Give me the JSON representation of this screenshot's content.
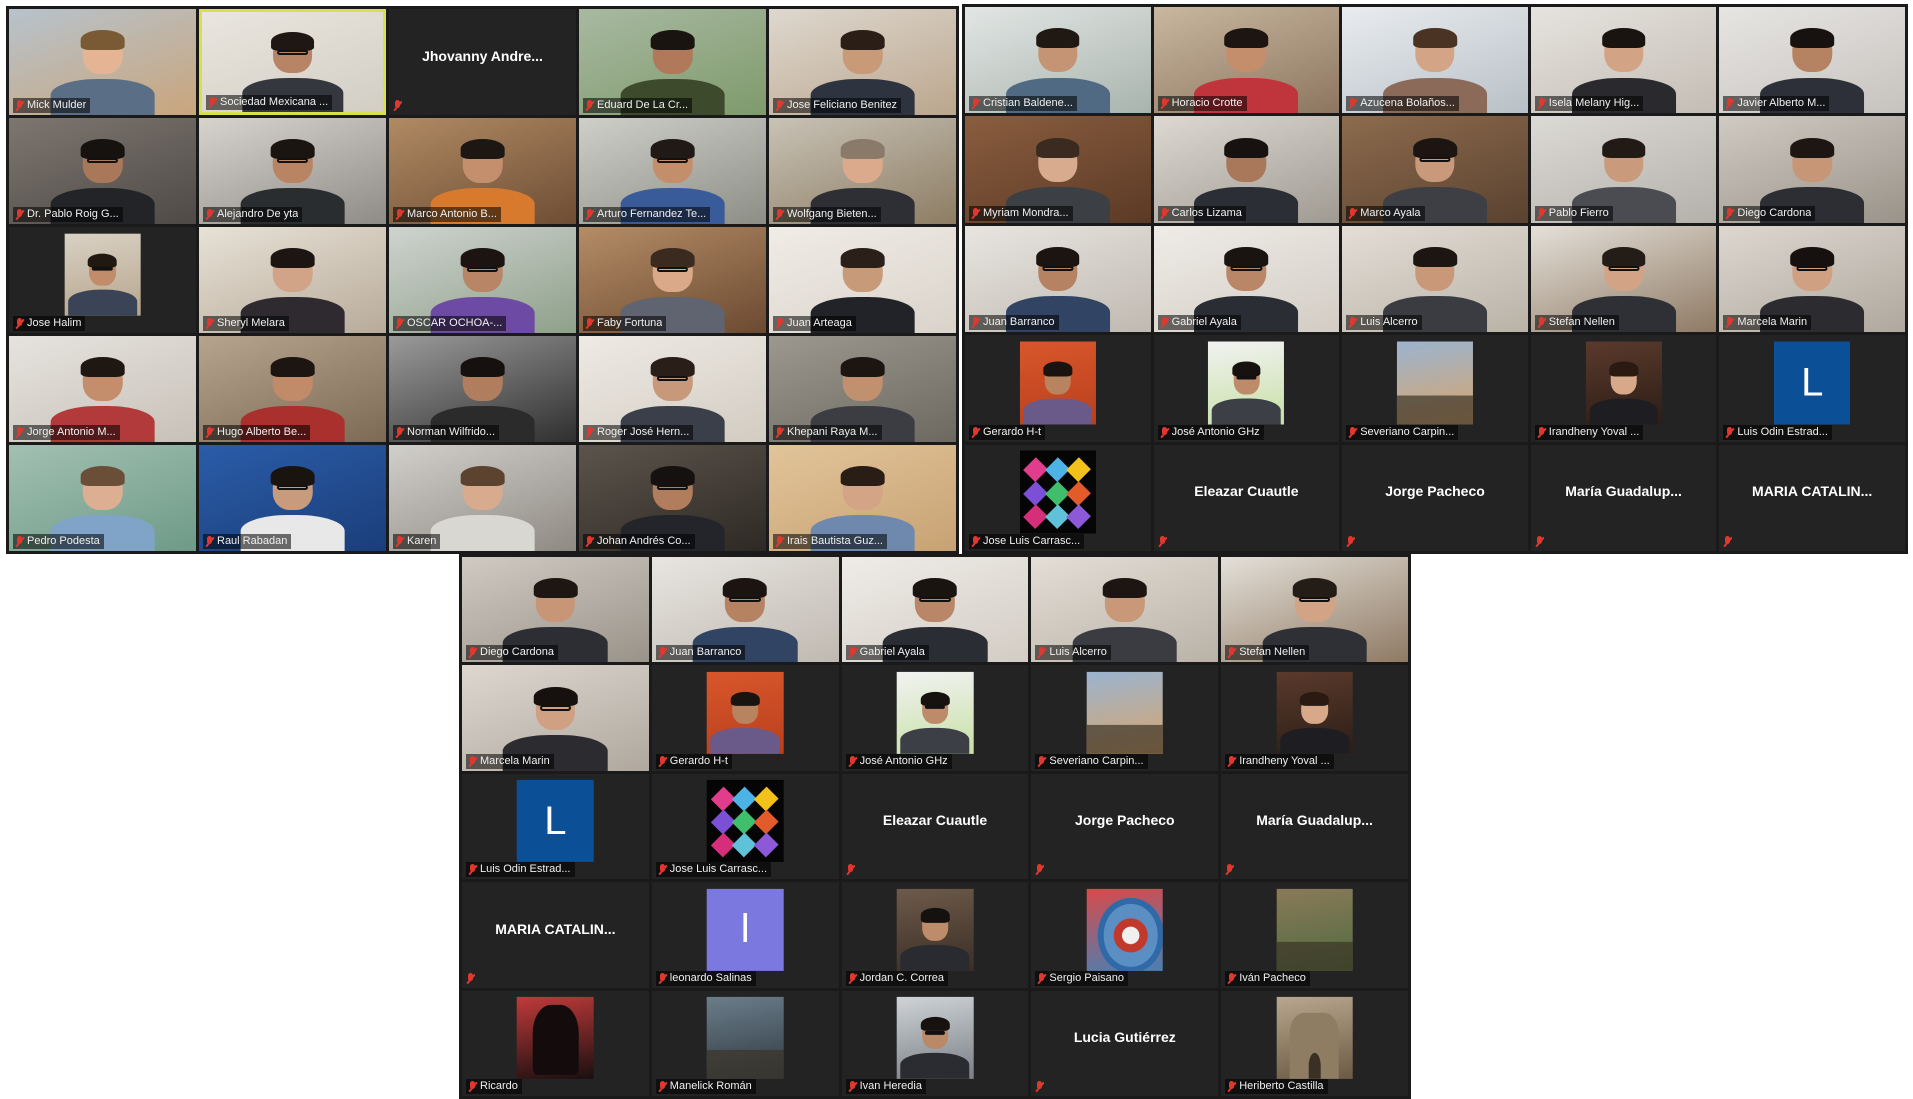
{
  "colors": {
    "muted_icon": "#e0382f",
    "active_speaker_border": "#d8e04a",
    "panel_bg": "#1a1a1a"
  },
  "panels": [
    {
      "id": "a",
      "tiles": [
        {
          "name": "Mick Mulder",
          "kind": "video",
          "bg": [
            "#b7c3cc",
            "#c9a57c"
          ],
          "shirt": "#5a6e86",
          "skin": "#e4b495",
          "hair": "#7a5a35",
          "glasses": false
        },
        {
          "name": "Sociedad Mexicana ...",
          "kind": "video",
          "active": true,
          "bg": [
            "#e9e6df",
            "#d3cec4"
          ],
          "shirt": "#34383e",
          "skin": "#b78565",
          "hair": "#1f1713",
          "glasses": true
        },
        {
          "name": "Jhovanny Andre...",
          "kind": "name"
        },
        {
          "name": "Eduard De La Cr...",
          "kind": "video",
          "bg": [
            "#a8b9a1",
            "#7f9a6c"
          ],
          "shirt": "#3d4a2c",
          "skin": "#b07a5a",
          "hair": "#1a1411",
          "glasses": false
        },
        {
          "name": "Jose Feliciano Benitez",
          "kind": "video",
          "bg": [
            "#ded8cf",
            "#bba68d"
          ],
          "shirt": "#2e3340",
          "skin": "#c99a78",
          "hair": "#2b1e16",
          "glasses": false
        },
        {
          "name": "Dr. Pablo Roig G...",
          "kind": "video",
          "bg": [
            "#7d7670",
            "#4f4a46"
          ],
          "shirt": "#222428",
          "skin": "#a9785b",
          "hair": "#151210",
          "glasses": true
        },
        {
          "name": "Alejandro De yta",
          "kind": "video",
          "bg": [
            "#d7d3cd",
            "#8f8b86"
          ],
          "shirt": "#2a2d30",
          "skin": "#b88463",
          "hair": "#1b1512",
          "glasses": true
        },
        {
          "name": "Marco Antonio B...",
          "kind": "video",
          "bg": [
            "#b08a63",
            "#6e4d34"
          ],
          "shirt": "#d87a2e",
          "skin": "#c48f6d",
          "hair": "#1d1713",
          "glasses": false
        },
        {
          "name": "Arturo Fernandez Te...",
          "kind": "video",
          "bg": [
            "#cfcfc9",
            "#8d8e86"
          ],
          "shirt": "#3a5b9a",
          "skin": "#c38e6c",
          "hair": "#201915",
          "glasses": true
        },
        {
          "name": "Wolfgang Bieten...",
          "kind": "video",
          "bg": [
            "#c8c2b6",
            "#8d7d63"
          ],
          "shirt": "#2d2f35",
          "skin": "#dba98b",
          "hair": "#8a7a6a",
          "glasses": false
        },
        {
          "name": "Jose Halim",
          "kind": "photo",
          "bg": [
            "#2a2a2a",
            "#2a2a2a"
          ],
          "photo_bg": [
            "#d9d1c4",
            "#b6a58c"
          ],
          "shirt": "#3b4456",
          "skin": "#c08c6a",
          "hair": "#21180f",
          "glasses": true
        },
        {
          "name": "Sheryl Melara",
          "kind": "video",
          "bg": [
            "#e7e1d6",
            "#b8ab9a"
          ],
          "shirt": "#2e2a30",
          "skin": "#d2a487",
          "hair": "#1d1512",
          "glasses": false
        },
        {
          "name": "OSCAR OCHOA-...",
          "kind": "video",
          "bg": [
            "#cfd3cf",
            "#8ea08a"
          ],
          "shirt": "#6d4aa3",
          "skin": "#b88666",
          "hair": "#1b1410",
          "glasses": true
        },
        {
          "name": "Faby Fortuna",
          "kind": "video",
          "bg": [
            "#b48c66",
            "#6c4a31"
          ],
          "shirt": "#5f6470",
          "skin": "#d9a98a",
          "hair": "#3a2a20",
          "glasses": true
        },
        {
          "name": "Juan Arteaga",
          "kind": "video",
          "bg": [
            "#f0ece6",
            "#d9d3ca"
          ],
          "shirt": "#222328",
          "skin": "#c79a7a",
          "hair": "#2a2019",
          "glasses": false
        },
        {
          "name": "Jorge Antonio M...",
          "kind": "video",
          "bg": [
            "#e6e3de",
            "#c7c1b8"
          ],
          "shirt": "#b23a3a",
          "skin": "#c48d6b",
          "hair": "#1f1712",
          "glasses": false
        },
        {
          "name": "Hugo Alberto Be...",
          "kind": "video",
          "bg": [
            "#b6a48e",
            "#7d6a55"
          ],
          "shirt": "#a9302c",
          "skin": "#c18b69",
          "hair": "#1c1511",
          "glasses": false
        },
        {
          "name": "Norman Wilfrido...",
          "kind": "video",
          "bg": [
            "#9a9a9a",
            "#2f2f2f"
          ],
          "shirt": "#2b2b2b",
          "skin": "#b07e5e",
          "hair": "#16110e",
          "glasses": false
        },
        {
          "name": "Roger José Hern...",
          "kind": "video",
          "bg": [
            "#eeeae4",
            "#d2ccc2"
          ],
          "shirt": "#3a3f4a",
          "skin": "#c8987a",
          "hair": "#2a1f18",
          "glasses": true
        },
        {
          "name": "Khepani Raya M...",
          "kind": "video",
          "bg": [
            "#9c9890",
            "#6c6961"
          ],
          "shirt": "#3b3d42",
          "skin": "#c0906f",
          "hair": "#1c1511",
          "glasses": false
        },
        {
          "name": "Pedro Podesta",
          "kind": "video",
          "bg": [
            "#a2c0b2",
            "#6e9a88"
          ],
          "shirt": "#7fa4c8",
          "skin": "#dcae92",
          "hair": "#6a4e37",
          "glasses": false
        },
        {
          "name": "Raul Rabadan",
          "kind": "video",
          "bg": [
            "#2b5ca8",
            "#1a3e7a"
          ],
          "shirt": "#e8e8e8",
          "skin": "#c89b7c",
          "hair": "#1a1411",
          "glasses": true
        },
        {
          "name": "Karen",
          "kind": "video",
          "bg": [
            "#d1cfcb",
            "#8f8a83"
          ],
          "shirt": "#d9d7d2",
          "skin": "#d8ab8e",
          "hair": "#5c4330",
          "glasses": false
        },
        {
          "name": "Johan Andrés Co...",
          "kind": "video",
          "bg": [
            "#5c544c",
            "#2e2924"
          ],
          "shirt": "#23252a",
          "skin": "#b17d5c",
          "hair": "#151110",
          "glasses": true
        },
        {
          "name": "Irais Bautista Guz...",
          "kind": "video",
          "bg": [
            "#e2c49a",
            "#c7a273"
          ],
          "shirt": "#6e89ad",
          "skin": "#d4a486",
          "hair": "#2a1d16",
          "glasses": false
        }
      ]
    },
    {
      "id": "b",
      "tiles": [
        {
          "name": "Cristian Baldene...",
          "kind": "video",
          "bg": [
            "#e2e6e4",
            "#a9b4ae"
          ],
          "shirt": "#4f6a82",
          "skin": "#c59474",
          "hair": "#1f1813",
          "glasses": false
        },
        {
          "name": "Horacio Crotte",
          "kind": "video",
          "bg": [
            "#c9b7a0",
            "#8d7660"
          ],
          "shirt": "#c0343c",
          "skin": "#c48e6d",
          "hair": "#1c1511",
          "glasses": false
        },
        {
          "name": "Azucena Bolaños...",
          "kind": "video",
          "bg": [
            "#e9ecef",
            "#b8c0c7"
          ],
          "shirt": "#8b6a5a",
          "skin": "#d4a487",
          "hair": "#4b3323",
          "glasses": false
        },
        {
          "name": "Isela Melany Hig...",
          "kind": "video",
          "bg": [
            "#e6e3de",
            "#c3bdb4"
          ],
          "shirt": "#2a2a2e",
          "skin": "#d3a385",
          "hair": "#1a1411",
          "glasses": false
        },
        {
          "name": "Javier Alberto M...",
          "kind": "video",
          "bg": [
            "#e7e5e2",
            "#c6c3bf"
          ],
          "shirt": "#2d3038",
          "skin": "#b68362",
          "hair": "#17120f",
          "glasses": false
        },
        {
          "name": "Myriam Mondra...",
          "kind": "video",
          "bg": [
            "#8a5d3f",
            "#5b3a25"
          ],
          "shirt": "#3c3f44",
          "skin": "#d8ab8e",
          "hair": "#3a2a1f",
          "glasses": false
        },
        {
          "name": "Carlos Lizama",
          "kind": "video",
          "bg": [
            "#ddd9d2",
            "#9f9a92"
          ],
          "shirt": "#2b2e34",
          "skin": "#a9785a",
          "hair": "#17120f",
          "glasses": false
        },
        {
          "name": "Marco Ayala",
          "kind": "video",
          "bg": [
            "#8d6b4d",
            "#5a4230"
          ],
          "shirt": "#3d3f45",
          "skin": "#c8997a",
          "hair": "#1c1511",
          "glasses": true
        },
        {
          "name": "Pablo Fierro",
          "kind": "video",
          "bg": [
            "#dcdad6",
            "#b4b0aa"
          ],
          "shirt": "#4a4c52",
          "skin": "#c99b7c",
          "hair": "#221a15",
          "glasses": false
        },
        {
          "name": "Diego Cardona",
          "kind": "video",
          "bg": [
            "#cfcac2",
            "#9a938a"
          ],
          "shirt": "#2c2e33",
          "skin": "#c69676",
          "hair": "#1d1612",
          "glasses": false
        },
        {
          "name": "Juan Barranco",
          "kind": "video",
          "bg": [
            "#e8e5e0",
            "#bfb9b1"
          ],
          "shirt": "#324464",
          "skin": "#b58262",
          "hair": "#1b1411",
          "glasses": true
        },
        {
          "name": "Gabriel Ayala",
          "kind": "video",
          "bg": [
            "#efece7",
            "#d2ccc4"
          ],
          "shirt": "#2a2d33",
          "skin": "#b98767",
          "hair": "#1a1411",
          "glasses": true
        },
        {
          "name": "Luis Alcerro",
          "kind": "video",
          "bg": [
            "#e3ded6",
            "#b9b2a7"
          ],
          "shirt": "#3a3c42",
          "skin": "#c89878",
          "hair": "#1c1511",
          "glasses": false
        },
        {
          "name": "Stefan Nellen",
          "kind": "video",
          "bg": [
            "#e4e0d9",
            "#8f7a64"
          ],
          "shirt": "#2e3036",
          "skin": "#d2a384",
          "hair": "#241c16",
          "glasses": true
        },
        {
          "name": "Marcela Marin",
          "kind": "video",
          "bg": [
            "#ddd7d0",
            "#b0a89e"
          ],
          "shirt": "#2c2c30",
          "skin": "#d0a082",
          "hair": "#16110e",
          "glasses": true
        },
        {
          "name": "Gerardo H-t",
          "kind": "photo",
          "bg": [
            "#232323",
            "#232323"
          ],
          "photo_bg": [
            "#d9562b",
            "#b8401d"
          ],
          "shirt": "#6a5a8a",
          "skin": "#b8835f",
          "hair": "#1a1410",
          "glasses": false
        },
        {
          "name": "José Antonio GHz",
          "kind": "photo",
          "bg": [
            "#232323",
            "#232323"
          ],
          "photo_bg": [
            "#f2f2f2",
            "#c7e0a5"
          ],
          "shirt": "#3c3f46",
          "skin": "#bd8b6a",
          "hair": "#17120f",
          "glasses": true
        },
        {
          "name": "Severiano Carpin...",
          "kind": "photo",
          "bg": [
            "#232323",
            "#232323"
          ],
          "photo_bg": [
            "#9bb4d0",
            "#d9a56a"
          ],
          "landscape": true
        },
        {
          "name": "Irandheny Yoval ...",
          "kind": "photo",
          "bg": [
            "#232323",
            "#232323"
          ],
          "photo_bg": [
            "#5a3a2c",
            "#2c1d16"
          ],
          "shirt": "#1e1e22",
          "skin": "#d7a88a",
          "hair": "#2a1a12",
          "glasses": false
        },
        {
          "name": "Luis Odin Estrad...",
          "kind": "letter",
          "letter": "L",
          "letter_bg": "#0b4f97"
        },
        {
          "name": "Jose Luis Carrasc...",
          "kind": "logo"
        },
        {
          "name": "Eleazar Cuautle",
          "kind": "name"
        },
        {
          "name": "Jorge Pacheco",
          "kind": "name"
        },
        {
          "name": "María  Guadalup...",
          "kind": "name"
        },
        {
          "name": "MARIA CATALIN...",
          "kind": "name"
        }
      ]
    },
    {
      "id": "c",
      "tiles": [
        {
          "name": "Diego Cardona",
          "kind": "video",
          "bg": [
            "#cfcac2",
            "#9a938a"
          ],
          "shirt": "#2c2e33",
          "skin": "#c69676",
          "hair": "#1d1612",
          "glasses": false
        },
        {
          "name": "Juan Barranco",
          "kind": "video",
          "bg": [
            "#e8e5e0",
            "#bfb9b1"
          ],
          "shirt": "#324464",
          "skin": "#b58262",
          "hair": "#1b1411",
          "glasses": true
        },
        {
          "name": "Gabriel Ayala",
          "kind": "video",
          "bg": [
            "#efece7",
            "#d2ccc4"
          ],
          "shirt": "#2a2d33",
          "skin": "#b98767",
          "hair": "#1a1411",
          "glasses": true
        },
        {
          "name": "Luis Alcerro",
          "kind": "video",
          "bg": [
            "#e3ded6",
            "#b9b2a7"
          ],
          "shirt": "#3a3c42",
          "skin": "#c89878",
          "hair": "#1c1511",
          "glasses": false
        },
        {
          "name": "Stefan Nellen",
          "kind": "video",
          "bg": [
            "#e4e0d9",
            "#8f7a64"
          ],
          "shirt": "#2e3036",
          "skin": "#d2a384",
          "hair": "#241c16",
          "glasses": true
        },
        {
          "name": "Marcela Marin",
          "kind": "video",
          "bg": [
            "#ddd7d0",
            "#b0a89e"
          ],
          "shirt": "#2c2c30",
          "skin": "#d0a082",
          "hair": "#16110e",
          "glasses": true
        },
        {
          "name": "Gerardo H-t",
          "kind": "photo",
          "bg": [
            "#232323",
            "#232323"
          ],
          "photo_bg": [
            "#d9562b",
            "#b8401d"
          ],
          "shirt": "#6a5a8a",
          "skin": "#b8835f",
          "hair": "#1a1410",
          "glasses": false
        },
        {
          "name": "José Antonio GHz",
          "kind": "photo",
          "bg": [
            "#232323",
            "#232323"
          ],
          "photo_bg": [
            "#f2f2f2",
            "#c7e0a5"
          ],
          "shirt": "#3c3f46",
          "skin": "#bd8b6a",
          "hair": "#17120f",
          "glasses": true
        },
        {
          "name": "Severiano Carpin...",
          "kind": "photo",
          "bg": [
            "#232323",
            "#232323"
          ],
          "photo_bg": [
            "#9bb4d0",
            "#d9a56a"
          ],
          "landscape": true
        },
        {
          "name": "Irandheny Yoval ...",
          "kind": "photo",
          "bg": [
            "#232323",
            "#232323"
          ],
          "photo_bg": [
            "#5a3a2c",
            "#2c1d16"
          ],
          "shirt": "#1e1e22",
          "skin": "#d7a88a",
          "hair": "#2a1a12",
          "glasses": false
        },
        {
          "name": "Luis Odin Estrad...",
          "kind": "letter",
          "letter": "L",
          "letter_bg": "#0b4f97"
        },
        {
          "name": "Jose Luis Carrasc...",
          "kind": "logo"
        },
        {
          "name": "Eleazar Cuautle",
          "kind": "name"
        },
        {
          "name": "Jorge Pacheco",
          "kind": "name"
        },
        {
          "name": "María  Guadalup...",
          "kind": "name"
        },
        {
          "name": "MARIA CATALIN...",
          "kind": "name"
        },
        {
          "name": "leonardo Salinas",
          "kind": "letter",
          "letter": "l",
          "letter_bg": "#7b78e0"
        },
        {
          "name": "Jordan C. Correa",
          "kind": "photo",
          "bg": [
            "#232323",
            "#232323"
          ],
          "photo_bg": [
            "#6d5a4a",
            "#3b2e25"
          ],
          "shirt": "#2a2b30",
          "skin": "#bf8c6b",
          "hair": "#15110e",
          "glasses": false
        },
        {
          "name": "Sergio Paisano",
          "kind": "photo",
          "bg": [
            "#232323",
            "#232323"
          ],
          "photo_bg": [
            "#d84a4a",
            "#4a7fb3"
          ],
          "detector": true
        },
        {
          "name": "Iván Pacheco",
          "kind": "photo",
          "bg": [
            "#232323",
            "#232323"
          ],
          "photo_bg": [
            "#8a7a5a",
            "#4f6b3d"
          ],
          "landscape": true
        },
        {
          "name": "Ricardo",
          "kind": "photo",
          "bg": [
            "#232323",
            "#232323"
          ],
          "photo_bg": [
            "#c03a3a",
            "#1a0f0f"
          ],
          "dark": true
        },
        {
          "name": "Manelick Román",
          "kind": "photo",
          "bg": [
            "#232323",
            "#232323"
          ],
          "photo_bg": [
            "#6b7d8a",
            "#2f3a42"
          ],
          "landscape": true
        },
        {
          "name": "Ivan Heredia",
          "kind": "photo",
          "bg": [
            "#232323",
            "#232323"
          ],
          "photo_bg": [
            "#cfd3d6",
            "#7a8086"
          ],
          "shirt": "#2b2c31",
          "skin": "#b9896a",
          "hair": "#17120f",
          "glasses": true
        },
        {
          "name": "Lucia Gutiérrez",
          "kind": "name"
        },
        {
          "name": "Heriberto Castilla",
          "kind": "photo",
          "bg": [
            "#232323",
            "#232323"
          ],
          "photo_bg": [
            "#b8a78e",
            "#6c5b44"
          ],
          "building": true
        }
      ]
    }
  ]
}
